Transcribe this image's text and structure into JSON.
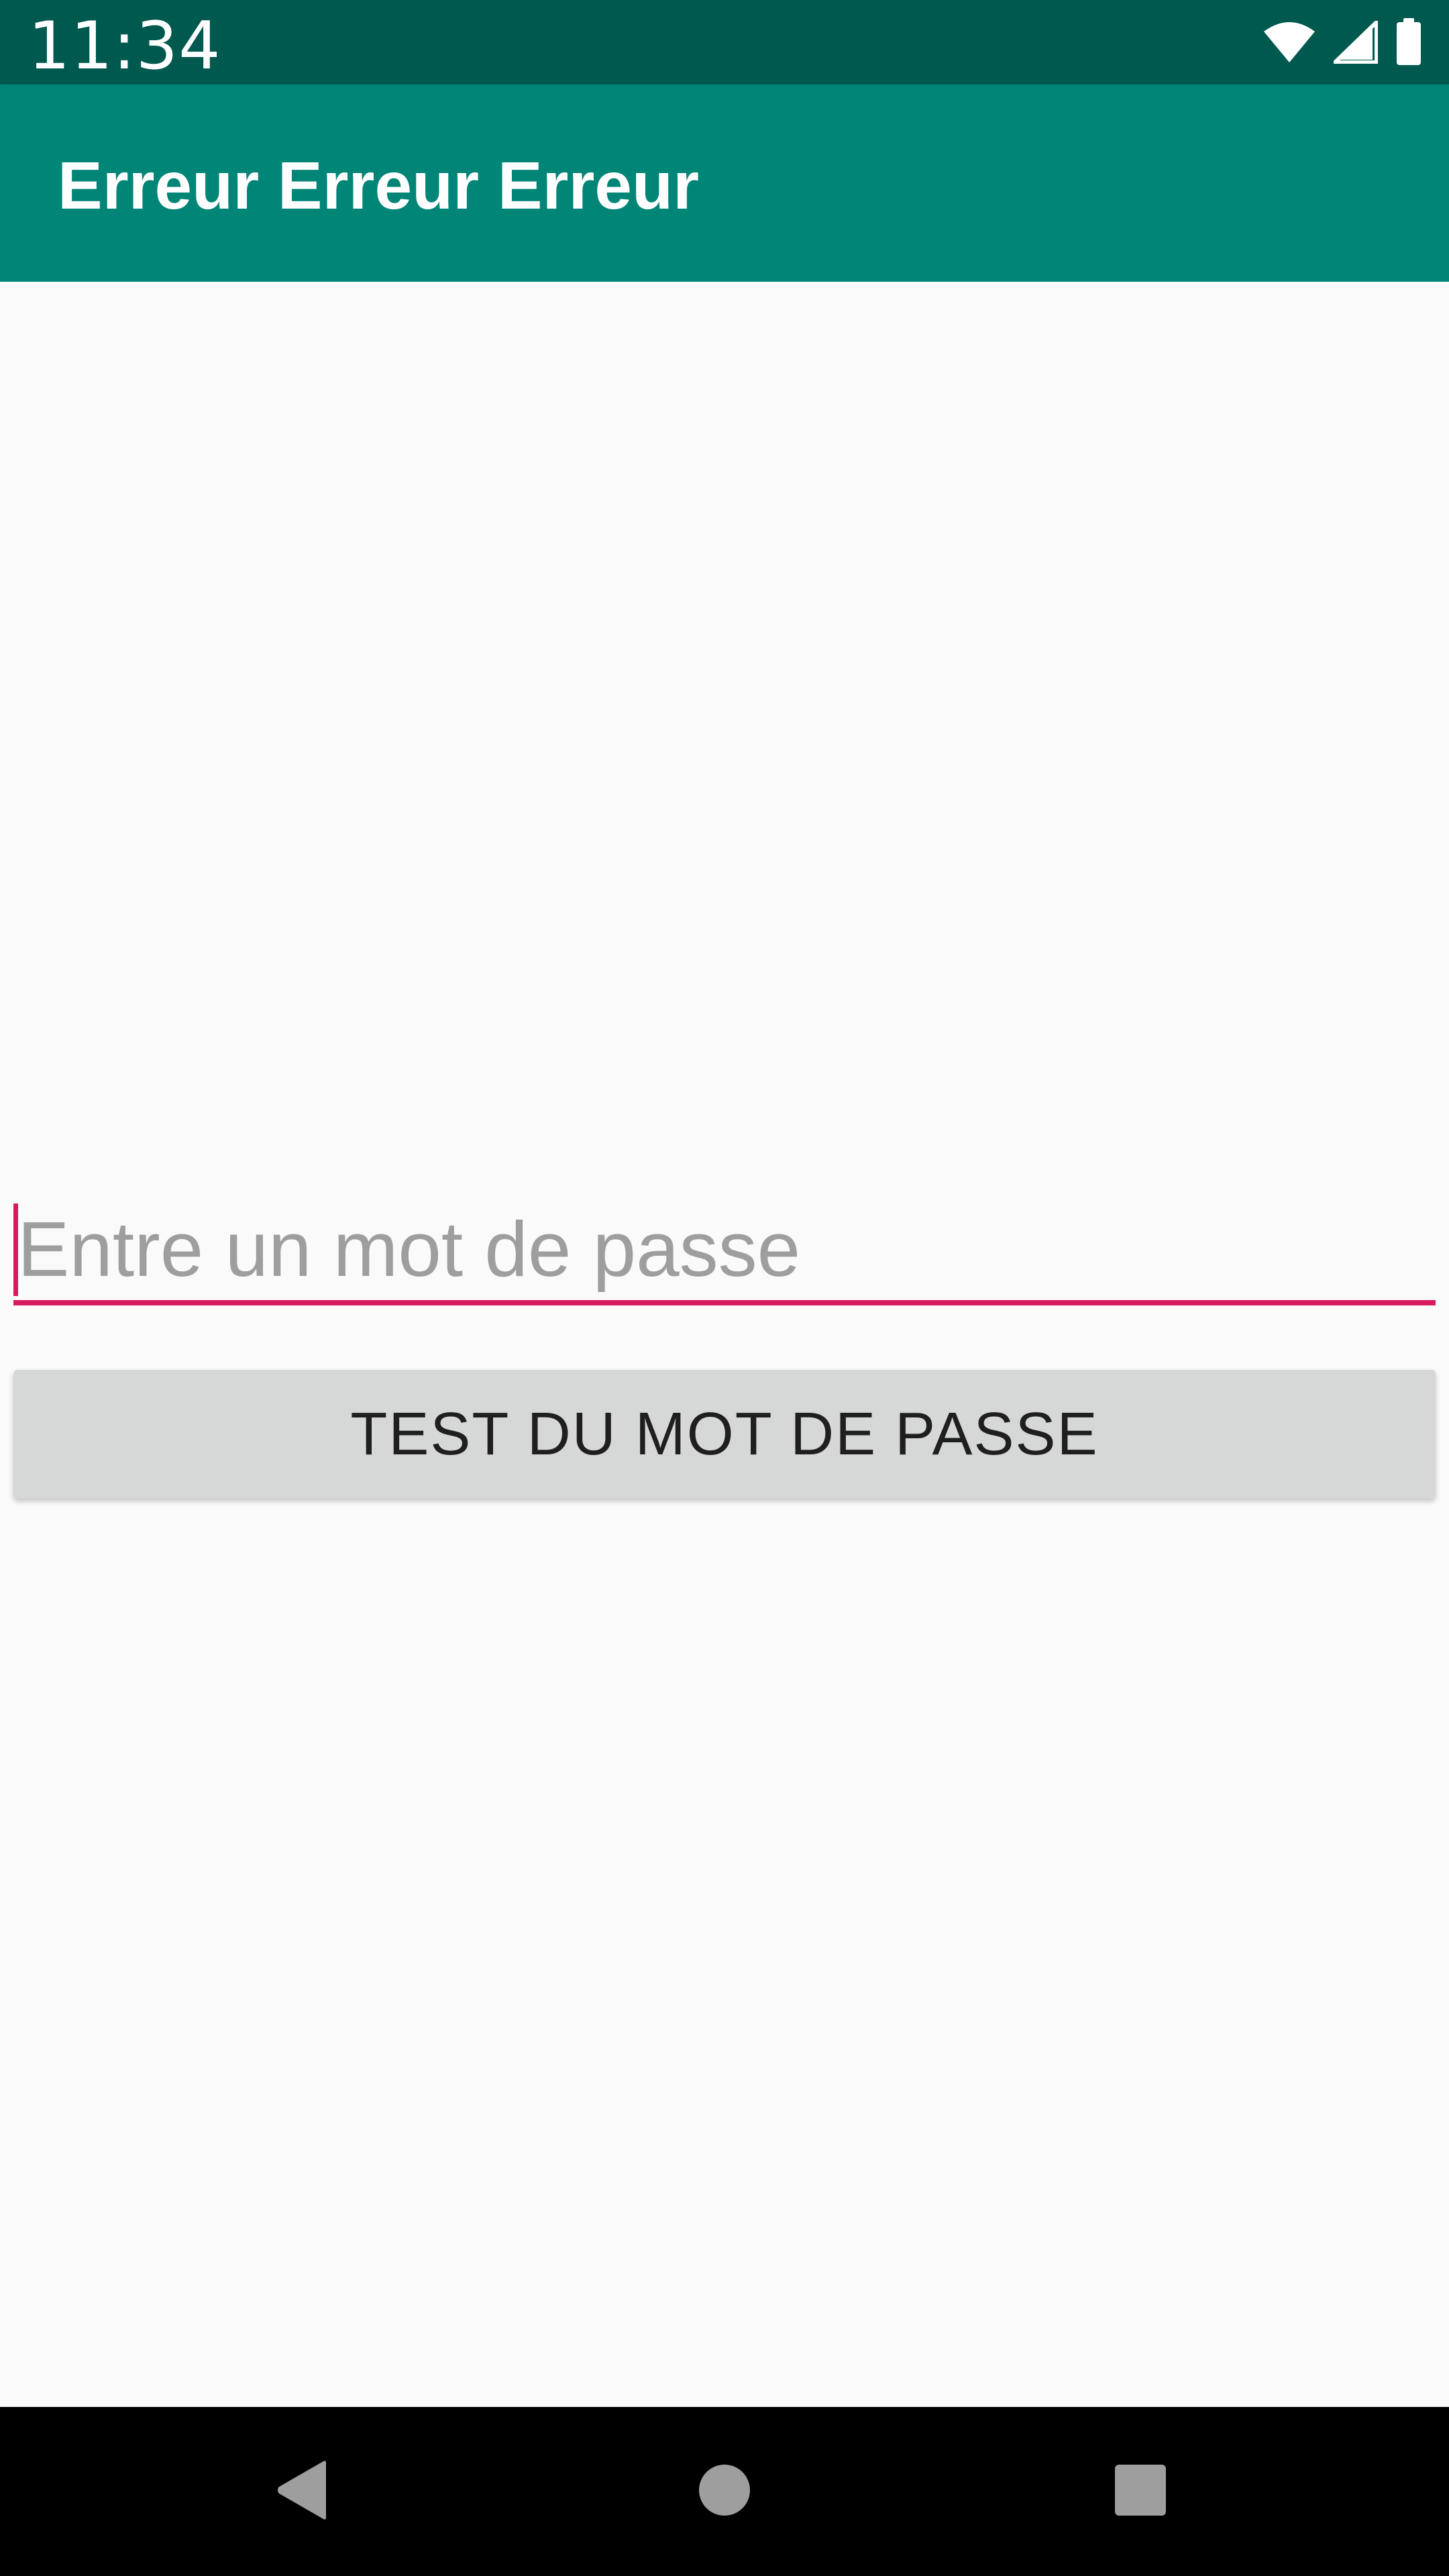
{
  "status_bar": {
    "time": "11:34",
    "background_color": "#00594f",
    "icons": [
      "wifi-icon",
      "cellular-signal-icon",
      "battery-icon"
    ]
  },
  "app_bar": {
    "title": "Erreur Erreur Erreur",
    "background_color": "#008577"
  },
  "form": {
    "password_field": {
      "placeholder": "Entre un mot de passe",
      "value": "",
      "accent_color": "#d81b60"
    },
    "test_button": {
      "label": "TEST DU MOT DE PASSE"
    }
  },
  "navigation_bar": {
    "buttons": [
      "back-icon",
      "home-icon",
      "recents-icon"
    ]
  }
}
